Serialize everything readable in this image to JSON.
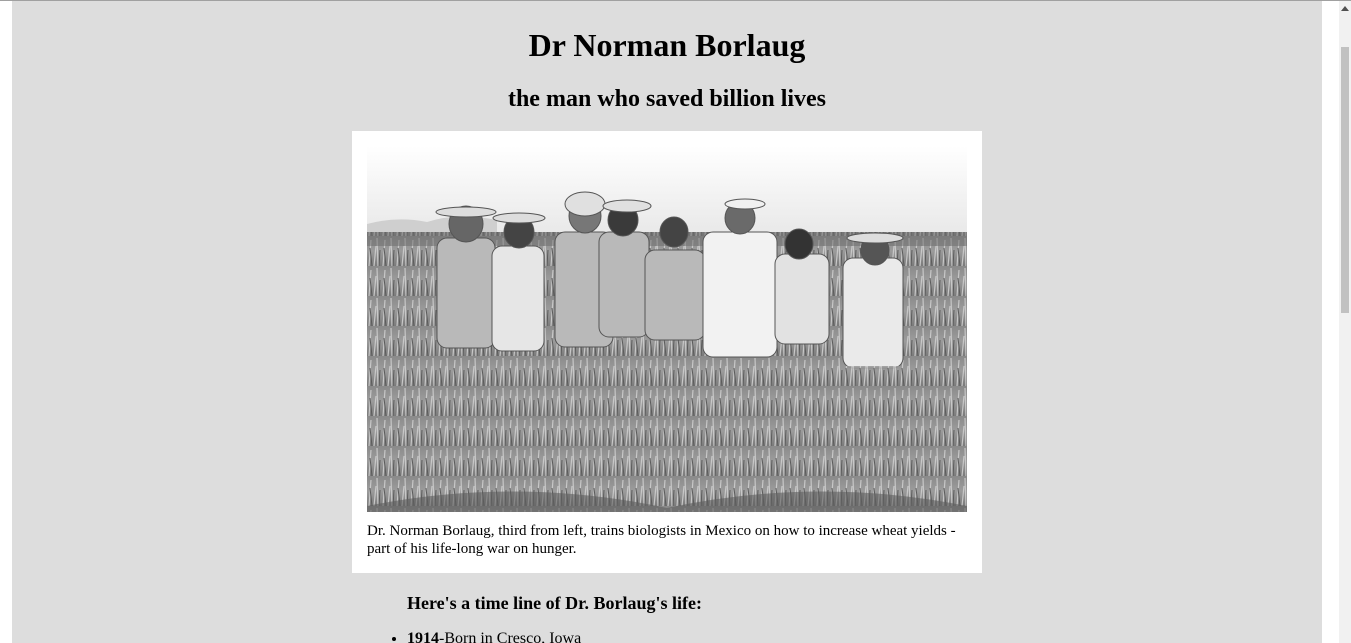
{
  "header": {
    "title": "Dr Norman Borlaug",
    "subtitle": "the man who saved billion lives"
  },
  "figure": {
    "caption": "Dr. Norman Borlaug, third from left, trains biologists in Mexico on how to increase wheat yields - part of his life-long war on hunger."
  },
  "timeline": {
    "heading": "Here's a time line of Dr. Borlaug's life:",
    "items": [
      {
        "year": "1914",
        "text": "-Born in Cresco, Iowa"
      }
    ]
  },
  "icons": {
    "scroll_up": "triangle-up-icon"
  }
}
